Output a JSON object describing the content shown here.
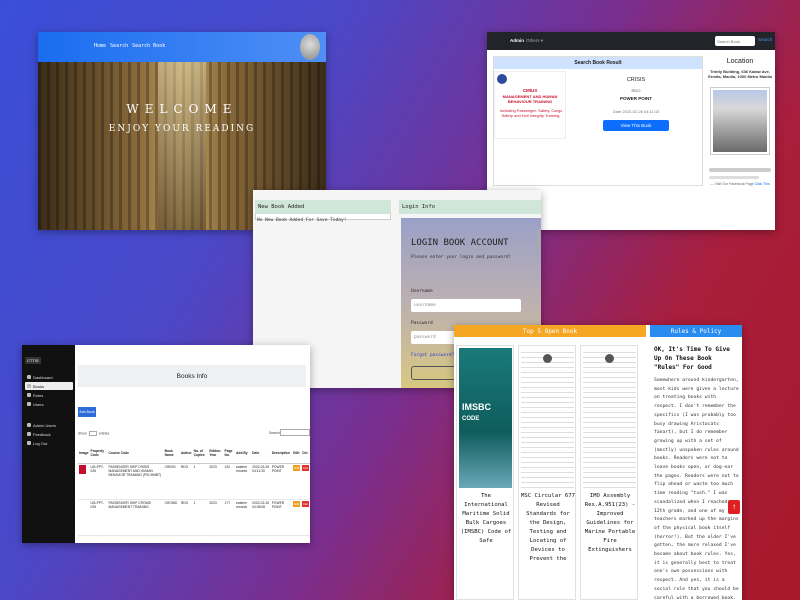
{
  "welcome_page": {
    "nav_links": [
      "Home",
      "Search",
      "Search Book"
    ],
    "welcome_text": "WELCOME",
    "enjoy_text": "ENJOY YOUR READING"
  },
  "search_page": {
    "brand": "Admin",
    "others_menu": "Others ▾",
    "search_placeholder": "Search Book",
    "search_button": "Search",
    "result_header": "Search Book Result",
    "cover_title_1": "CMIUS",
    "cover_title_2": "MANAGEMENT AND HUMAN BEHAVIOUR TRAINING",
    "cover_subtitle": "Including Passenger: Safety, Cargo Safety and Hull Integrity Training.",
    "book_code": "CRISIS",
    "book_author": "RDO",
    "book_format": "POWER POINT",
    "book_date": "Date 2023-02-26 04:11:33",
    "view_button": "View This Book",
    "location_title": "Location",
    "location_address": "Trinity Building, 636 Kalaw Ave, Ermita, Manila, 1000 Metro Manila",
    "location_link_prefix": "— Visit Our Facebook Page",
    "location_link_text": "Click This"
  },
  "newbook_login": {
    "newbook_header": "New Book Added",
    "newbook_message": "No New Book Added For Save Today!",
    "login_header": "Login Info",
    "login_title": "LOGIN BOOK ACCOUNT",
    "login_subtitle": "Please enter your login and password!",
    "username_label": "Username",
    "username_placeholder": "username",
    "password_label": "Password",
    "password_placeholder": "password",
    "forgot_link": "Forgot password?"
  },
  "books_info": {
    "logo": "CTTIS",
    "sidebar": [
      "Dashboard",
      "Books",
      "Rules",
      "Users",
      "Admin Users",
      "Feedback",
      "Log Out"
    ],
    "title": "Books Info",
    "add_button": "Add Book",
    "show_label": "Show",
    "show_value": "10",
    "entries_label": "entries",
    "search_label": "Search:",
    "columns": [
      "Image",
      "Property Code",
      "Course Code",
      "Book Name",
      "Author",
      "No. of Copies",
      "Edition Year",
      "Page No.",
      "Add By",
      "Date",
      "Description",
      "Edit",
      "Del"
    ],
    "rows": [
      {
        "property": "LIB-PPT-026",
        "course": "PASSENGER SHIP CRISIS MANAGEMENT AND HUMAN BEHAVIOR TRAINING (PSCHMBT)",
        "name": "CRISIS",
        "author": "RDO",
        "copies": "1",
        "year": "2023",
        "pages": "120",
        "addby": "eastern records",
        "date": "2023-02-26 04:11:33",
        "desc": "POWER POINT",
        "edit": "Edit",
        "del": "Del"
      },
      {
        "property": "LIB-PPT-025",
        "course": "PASSENGER SHIP CROWD MANAGEMENT TRAINING",
        "name": "CROWD",
        "author": "RDO",
        "copies": "1",
        "year": "2023",
        "pages": "177",
        "addby": "eastern records",
        "date": "2023-02-26 04:08:08",
        "desc": "POWER POINT",
        "edit": "Edit",
        "del": "Del"
      }
    ]
  },
  "top_books": {
    "header": "Top 5 Open Book",
    "rules_header": "Rules & Policy",
    "cover1_big": "IMSBC",
    "cover1_small": "CODE",
    "books": [
      "The International Maritime Solid Bulk Cargoes (IMSBC) Code of Safe",
      "MSC Circular 677 Revised Standards for the Design, Testing and Locating of Devices to Prevent the",
      "IMO Assembly Res.A.951(23) - Improved Guidelines for Marine Portable Fire Extinguishers"
    ],
    "rules_title": "OK, It's Time To Give Up On These Book \"Rules\" For Good",
    "rules_body": "Somewhere around kindergarten, most kids were given a lecture on treating books with respect. I don't remember the specifics (I was probably too busy drawing Aristocats fanart), but I do remember growing up with a set of (mostly) unspoken rules around books. Readers were not to leave books open, or dog-ear the pages. Readers were not to flip ahead or waste too much time reading \"tush.\" I was scandalized when I reached 12th grade, and one of my teachers marked up the margins of the physical book itself (horror!). But the older I've gotten, the more relaxed I've become about book rules. Yes, it is generally best to treat one's own possessions with respect. And yes, it is a social rule that you should be careful with a borrowed book."
  }
}
